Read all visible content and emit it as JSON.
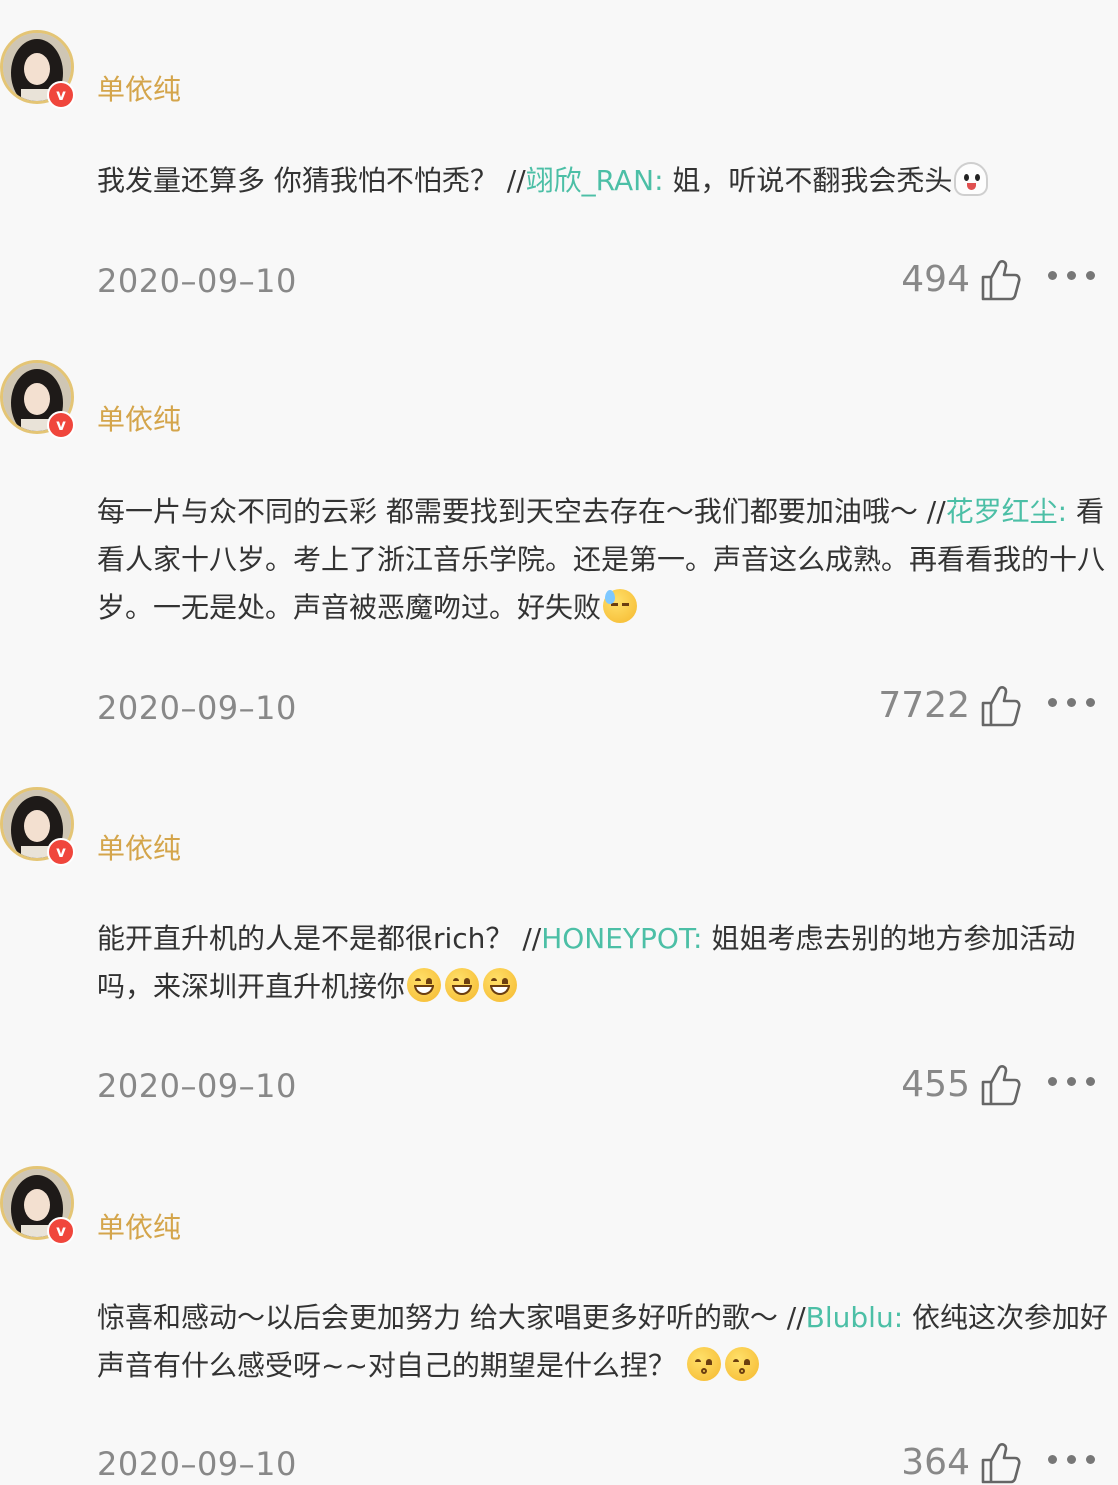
{
  "comments": [
    {
      "username": "单依纯",
      "text_before": "我发量还算多 你猜我怕不怕秃？ //",
      "mention": "翊欣_RAN:",
      "text_after": " 姐，听说不翻我会秃头",
      "emojis": [
        "ghost-emoji"
      ],
      "date": "2020–09–10",
      "likes": "494"
    },
    {
      "username": "单依纯",
      "text_before": "每一片与众不同的云彩 都需要找到天空去存在～我们都要加油哦～ //",
      "mention": "花罗红尘:",
      "text_after": " 看看人家十八岁。考上了浙江音乐学院。还是第一。声音这么成熟。再看看我的十八岁。一无是处。声音被恶魔吻过。好失败",
      "emojis": [
        "sweat-emoji"
      ],
      "date": "2020–09–10",
      "likes": "7722"
    },
    {
      "username": "单依纯",
      "text_before": "能开直升机的人是不是都很rich？ //",
      "mention": "HONEYPOT:",
      "text_after": " 姐姐考虑去别的地方参加活动吗，来深圳开直升机接你",
      "emojis": [
        "grin-emoji",
        "grin-emoji",
        "grin-emoji"
      ],
      "date": "2020–09–10",
      "likes": "455"
    },
    {
      "username": "单依纯",
      "text_before": "惊喜和感动～以后会更加努力 给大家唱更多好听的歌～ //",
      "mention": "Blublu:",
      "text_after": " 依纯这次参加好声音有什么感受呀~~对自己的期望是什么捏？",
      "emojis": [
        "kiss-emoji",
        "kiss-emoji"
      ],
      "date": "2020–09–10",
      "likes": "364"
    }
  ],
  "icons": {
    "badge": "verified-v-badge",
    "like": "thumbs-up-icon",
    "more": "more-dots-icon"
  },
  "badge_letter": "v",
  "colors": {
    "username": "#d4a54b",
    "mention": "#4cbfa6",
    "badge": "#f0463c",
    "avatar_ring": "#e4c575"
  }
}
